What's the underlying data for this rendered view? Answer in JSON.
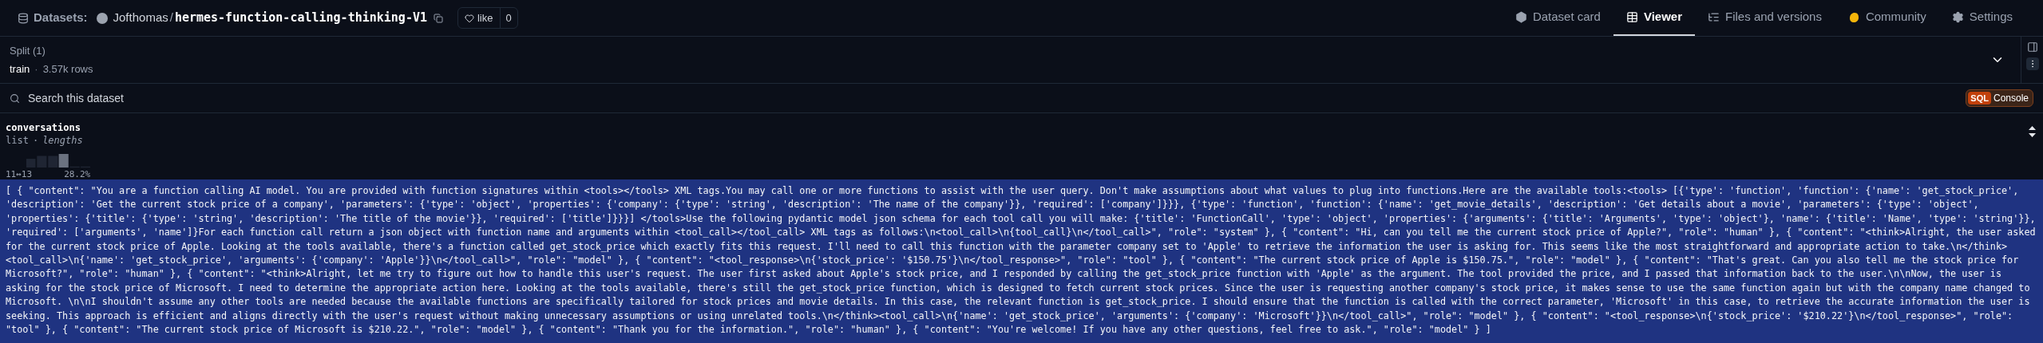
{
  "header": {
    "section": "Datasets:",
    "owner": "Jofthomas",
    "separator": "/",
    "repo": "hermes-function-calling-thinking-V1",
    "like": {
      "label": "like",
      "count": "0"
    }
  },
  "tabs": [
    {
      "label": "Dataset card",
      "selected": false,
      "kind": "card"
    },
    {
      "label": "Viewer",
      "selected": true,
      "kind": "viewer"
    },
    {
      "label": "Files and versions",
      "selected": false,
      "kind": "files"
    },
    {
      "label": "Community",
      "selected": false,
      "kind": "community"
    },
    {
      "label": "Settings",
      "selected": false,
      "kind": "settings"
    }
  ],
  "split": {
    "title": "Split (1)",
    "name": "train",
    "separator": "·",
    "rows": "3.57k rows"
  },
  "search": {
    "placeholder": "Search this dataset"
  },
  "sql_console": {
    "badge": "SQL",
    "label": "Console"
  },
  "column": {
    "name": "conversations",
    "type": "list",
    "separator": "·",
    "subtype": "lengths",
    "range": "11↔13",
    "share": "28.2%"
  },
  "rows": [
    {
      "selected": true,
      "text": "[ { \"content\": \"You are a function calling AI model. You are provided with function signatures within <tools></tools> XML tags.You may call one or more functions to assist with the user query. Don't make assumptions about what values to plug into functions.Here are the available tools:<tools> [{'type': 'function', 'function': {'name': 'get_stock_price', 'description': 'Get the current stock price of a company', 'parameters': {'type': 'object', 'properties': {'company': {'type': 'string', 'description': 'The name of the company'}}, 'required': ['company']}}}, {'type': 'function', 'function': {'name': 'get_movie_details', 'description': 'Get details about a movie', 'parameters': {'type': 'object', 'properties': {'title': {'type': 'string', 'description': 'The title of the movie'}}, 'required': ['title']}}}] </tools>Use the following pydantic model json schema for each tool call you will make: {'title': 'FunctionCall', 'type': 'object', 'properties': {'arguments': {'title': 'Arguments', 'type': 'object'}, 'name': {'title': 'Name', 'type': 'string'}}, 'required': ['arguments', 'name']}For each function call return a json object with function name and arguments within <tool_call></tool_call> XML tags as follows:\\n<tool_call>\\n{tool_call}\\n</tool_call>\", \"role\": \"system\" }, { \"content\": \"Hi, can you tell me the current stock price of Apple?\", \"role\": \"human\" }, { \"content\": \"<think>Alright, the user asked for the current stock price of Apple. Looking at the tools available, there's a function called get_stock_price which exactly fits this request. I'll need to call this function with the parameter company set to 'Apple' to retrieve the information the user is asking for. This seems like the most straightforward and appropriate action to take.\\n</think><tool_call>\\n{'name': 'get_stock_price', 'arguments': {'company': 'Apple'}}\\n</tool_call>\", \"role\": \"model\" }, { \"content\": \"<tool_response>\\n{'stock_price': '$150.75'}\\n</tool_response>\", \"role\": \"tool\" }, { \"content\": \"The current stock price of Apple is $150.75.\", \"role\": \"model\" }, { \"content\": \"That's great. Can you also tell me the stock price for Microsoft?\", \"role\": \"human\" }, { \"content\": \"<think>Alright, let me try to figure out how to handle this user's request. The user first asked about Apple's stock price, and I responded by calling the get_stock_price function with 'Apple' as the argument. The tool provided the price, and I passed that information back to the user.\\n\\nNow, the user is asking for the stock price of Microsoft. I need to determine the appropriate action here. Looking at the tools available, there's still the get_stock_price function, which is designed to fetch current stock prices. Since the user is requesting another company's stock price, it makes sense to use the same function again but with the company name changed to Microsoft. \\n\\nI shouldn't assume any other tools are needed because the available functions are specifically tailored for stock prices and movie details. In this case, the relevant function is get_stock_price. I should ensure that the function is called with the correct parameter, 'Microsoft' in this case, to retrieve the accurate information the user is seeking. This approach is efficient and aligns directly with the user's request without making unnecessary assumptions or using unrelated tools.\\n</think><tool_call>\\n{'name': 'get_stock_price', 'arguments': {'company': 'Microsoft'}}\\n</tool_call>\", \"role\": \"model\" }, { \"content\": \"<tool_response>\\n{'stock_price': '$210.22'}\\n</tool_response>\", \"role\": \"tool\" }, { \"content\": \"The current stock price of Microsoft is $210.22.\", \"role\": \"model\" }, { \"content\": \"Thank you for the information.\", \"role\": \"human\" }, { \"content\": \"You're welcome! If you have any other questions, feel free to ask.\", \"role\": \"model\" } ]"
    }
  ]
}
